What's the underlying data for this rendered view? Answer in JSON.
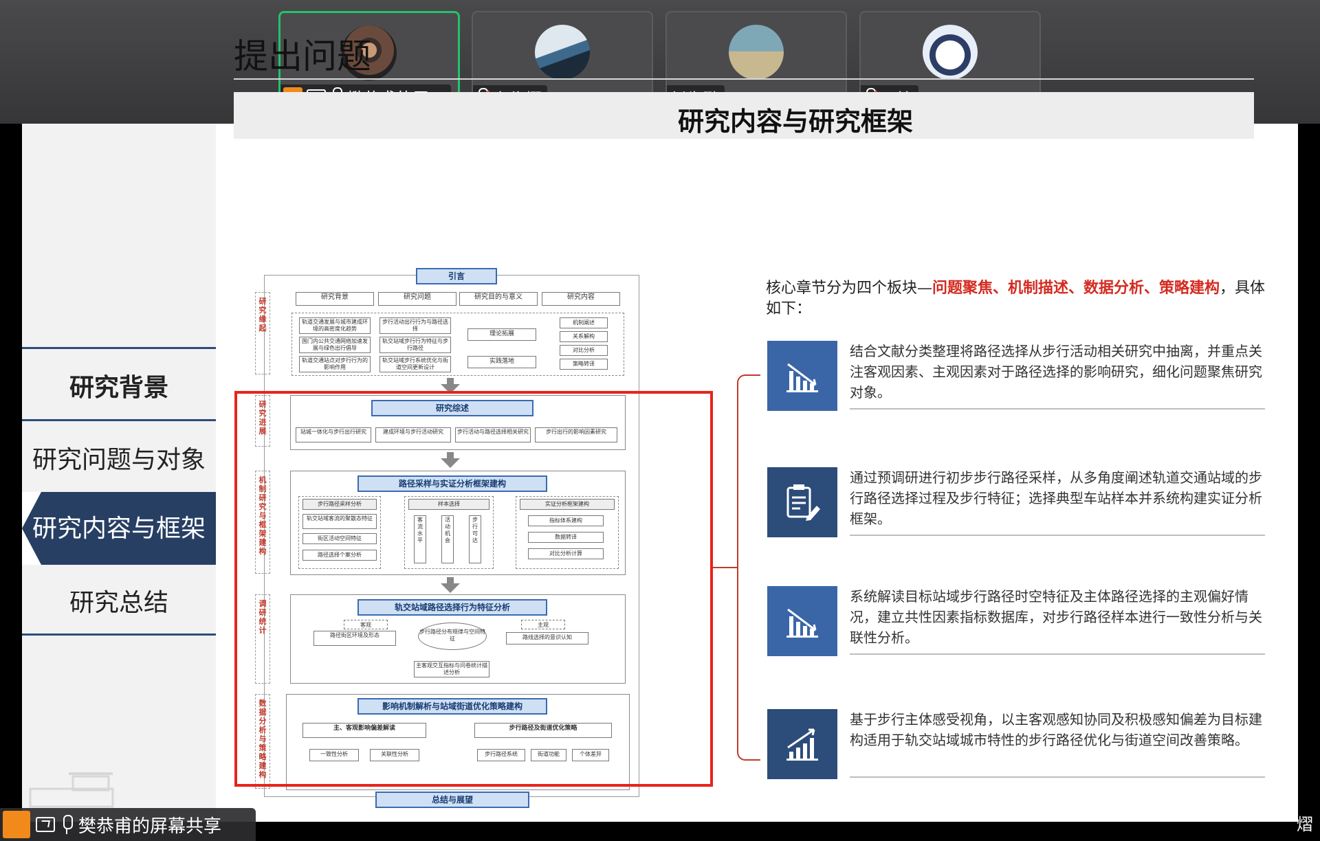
{
  "participants": [
    {
      "name": "樊恭甫的屏…",
      "active": true,
      "muted": false,
      "sharing": true
    },
    {
      "name": "宋俊熠",
      "active": false,
      "muted": true,
      "sharing": false
    },
    {
      "name": "刘先鹏",
      "active": false,
      "muted": false,
      "sharing": false
    },
    {
      "name": "翟植",
      "active": false,
      "muted": true,
      "sharing": false
    }
  ],
  "slide": {
    "title": "提出问题",
    "subtitle": "研究内容与研究框架",
    "sidebar": [
      {
        "label": "研究背景"
      },
      {
        "label": "研究问题与对象"
      },
      {
        "label": "研究内容与框架"
      },
      {
        "label": "研究总结"
      }
    ],
    "core_intro_pre": "核心章节分为四个板块—",
    "core_intro_hl": "问题聚焦、机制描述、数据分析、策略建构",
    "core_intro_post": "，具体如下：",
    "blocks": [
      {
        "text": "结合文献分类整理将路径选择从步行活动相关研究中抽离，并重点关注客观因素、主观因素对于路径选择的影响研究，细化问题聚焦研究对象。",
        "icon": "bar-chart-down-icon"
      },
      {
        "text": "通过预调研进行初步步行路径采样，从多角度阐述轨道交通站域的步行路径选择过程及步行特征；选择典型车站样本并系统构建实证分析框架。",
        "icon": "clipboard-pen-icon"
      },
      {
        "text": "系统解读目标站域步行路径时空特征及主体路径选择的主观偏好情况，建立共性因素指标数据库，对步行路径样本进行一致性分析与关联性分析。",
        "icon": "bar-chart-down-icon"
      },
      {
        "text": "基于步行主体感受视角，以主客观感知协同及积极感知偏差为目标建构适用于轨交站域城市特性的步行路径优化与街道空间改善策略。",
        "icon": "bar-chart-up-icon"
      }
    ]
  },
  "diagram": {
    "top": "引言",
    "intro_items": [
      "研究背景",
      "研究问题",
      "研究目的与意义",
      "研究内容"
    ],
    "bg_items": [
      "轨道交通发展与城市建成环境的高密度化趋势",
      "国门内公共交通网络加速发展与绿色出行倡导",
      "轨道交通站点对步行行为的影响作用"
    ],
    "prob_items": [
      "步行活动出行行为与路径选择",
      "轨交站域步行行为特征与步行路径",
      "轨交站域步行系统优化与街道空间更新设计"
    ],
    "method_items": [
      "理论拓展",
      "实践落地"
    ],
    "content_items": [
      "机制阐述",
      "关系解构",
      "对比分析",
      "策略转译"
    ],
    "side_labels": [
      "研究缘起",
      "研究进展",
      "机制研究与框架建构",
      "调研统计",
      "数据分析与策略建构"
    ],
    "sec2_title": "研究综述",
    "sec2_items": [
      "站城一体化与步行出行研究",
      "建成环境与步行活动研究",
      "步行活动与路径选择相关研究",
      "步行出行的影响因素研究"
    ],
    "sec3_title": "路径采样与实证分析框架建构",
    "sec3_cols": [
      "步行路径采样分析",
      "样本选择",
      "实证分析框架建构"
    ],
    "sec3_left": [
      "轨交站域客流的聚散态特征",
      "街区活动空间特征",
      "路径选择个案分析"
    ],
    "sec3_mid": [
      "客流水平",
      "活动机会",
      "步行可达"
    ],
    "sec3_right": [
      "指标体系建构",
      "数据转译",
      "对比分析计算"
    ],
    "sec4_title": "轨交站域路径选择行为特征分析",
    "sec4_obj": "客观",
    "sec4_subj": "主观",
    "sec4_obj_item": "路径街区环境及形态",
    "sec4_center": "步行路径分布规律与空间特征",
    "sec4_subj_item": "路线选择的意识认知",
    "sec4_bottom": "主客观交互指标与问卷统计描述分析",
    "sec5_title": "影响机制解析与站域街道优化策略建构",
    "sec5_left": "主、客观影响偏差解读",
    "sec5_right": "步行路径及街道优化策略",
    "sec5_left_items": [
      "一致性分析",
      "关联性分析"
    ],
    "sec5_right_items": [
      "步行路径系统",
      "街道功能",
      "个体差异"
    ],
    "bottom": "总结与展望"
  },
  "sharebar": {
    "label": "樊恭甫的屏幕共享"
  },
  "corner_text": "熠",
  "colors": {
    "accent_red": "#e8231b",
    "nav_active": "#273f63",
    "icon_blue": "#3a66a8",
    "active_border": "#22c46a"
  }
}
